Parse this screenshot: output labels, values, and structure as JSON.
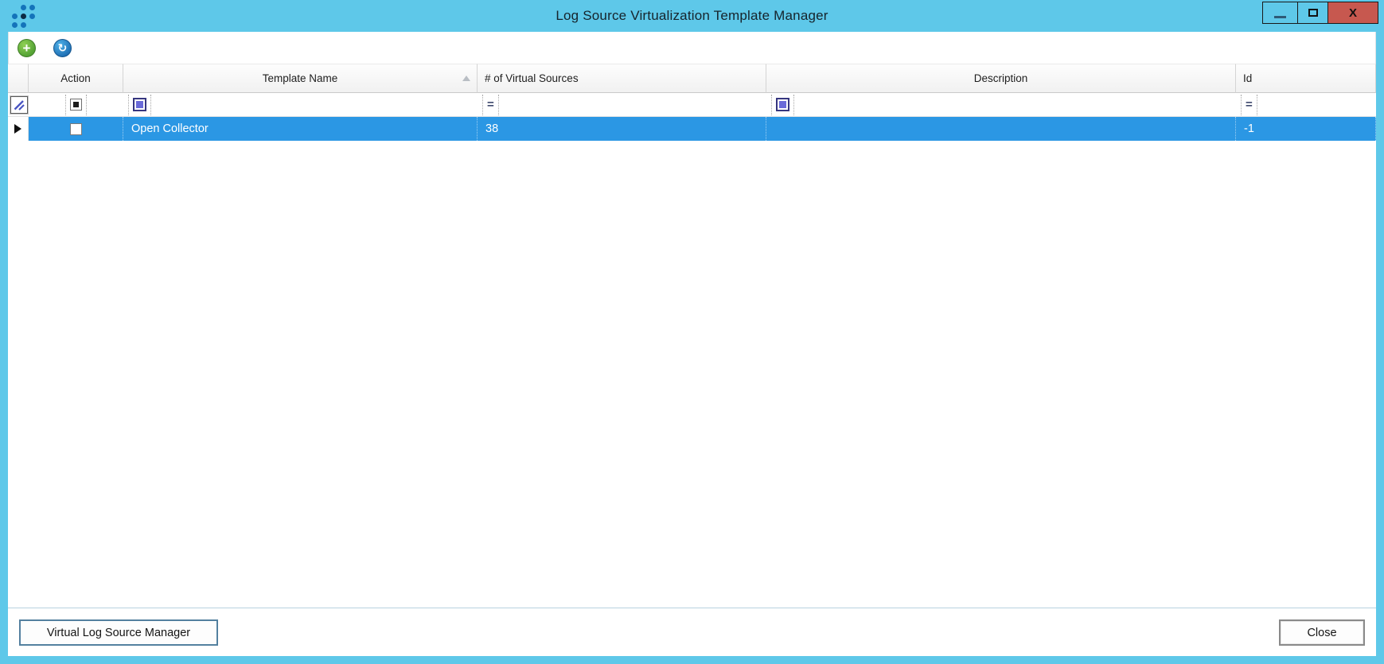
{
  "window": {
    "title": "Log Source Virtualization Template Manager",
    "controls": {
      "close_glyph": "X"
    }
  },
  "toolbar": {
    "add_glyph": "+",
    "refresh_glyph": "↻"
  },
  "grid": {
    "columns": {
      "action": "Action",
      "template_name": "Template Name",
      "virtual_sources": "# of Virtual Sources",
      "description": "Description",
      "id": "Id"
    },
    "sort": {
      "column": "Template Name",
      "direction": "ascending"
    },
    "filter": {
      "action_state": "indeterminate",
      "template_name_state": "indeterminate",
      "virtual_sources_operator": "=",
      "description_state": "indeterminate",
      "id_operator": "="
    },
    "rows": [
      {
        "selected": true,
        "action_checked": false,
        "template_name": "Open Collector",
        "virtual_sources": "38",
        "description": "",
        "id": "-1"
      }
    ]
  },
  "footer": {
    "manager_button": "Virtual Log Source Manager",
    "close_button": "Close"
  },
  "colors": {
    "titlebar": "#5ec8e9",
    "selection": "#2b97e4",
    "close_button": "#c7584f",
    "add_icon_green": "#55a335",
    "refresh_icon_blue": "#1f6fb4",
    "filter_checkbox_blue": "#6a6ad9"
  }
}
